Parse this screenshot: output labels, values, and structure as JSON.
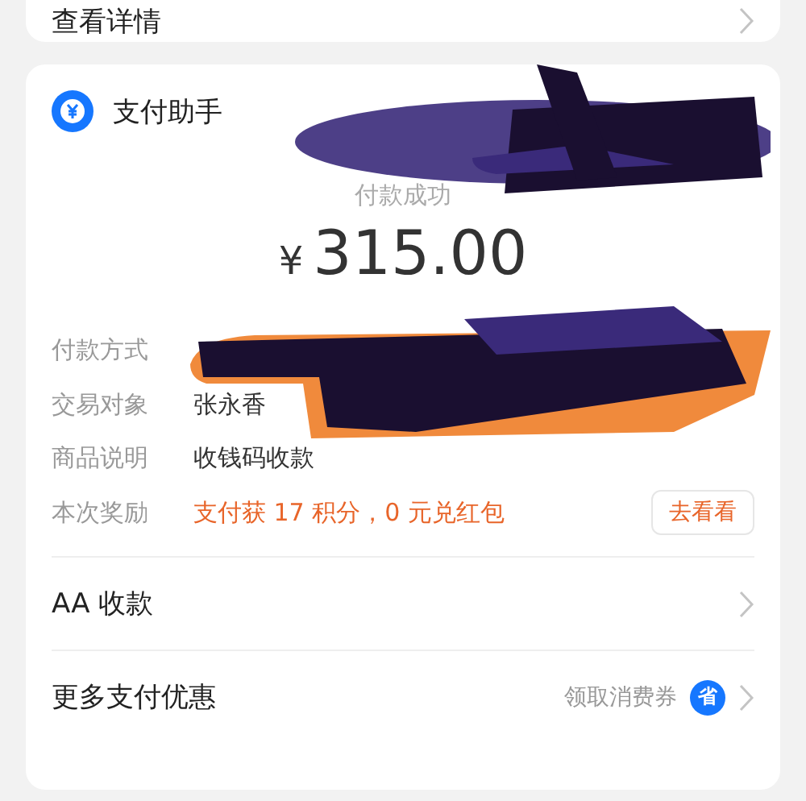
{
  "top_card": {
    "link": "查看详情"
  },
  "assistant": {
    "title": "支付助手",
    "status": "付款成功",
    "currency": "¥",
    "amount": "315.00",
    "details": [
      {
        "label": "付款方式",
        "kind": "hidden"
      },
      {
        "label": "交易对象",
        "value": "张永香",
        "kind": "plain"
      },
      {
        "label": "商品说明",
        "value": "收钱码收款",
        "kind": "plain"
      },
      {
        "label": "本次奖励",
        "value": "支付获 17 积分，0 元兑红包",
        "kind": "reward",
        "button": "去看看"
      }
    ]
  },
  "menu": [
    {
      "label": "AA 收款"
    },
    {
      "label": "更多支付优惠",
      "hint": "领取消费券",
      "badge": "省"
    }
  ]
}
